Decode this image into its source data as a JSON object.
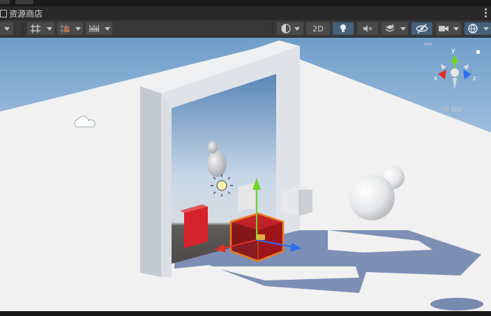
{
  "window": {
    "panel_title": "资源商店"
  },
  "toolbar": {
    "btn_2d_label": "2D"
  },
  "gizmo": {
    "axis_x": "x",
    "axis_y": "y",
    "axis_z": "z",
    "projection_label": "Iso"
  },
  "colors": {
    "selection_outline": "#f07a1e",
    "x_axis": "#e0302a",
    "y_axis": "#6fd624",
    "z_axis": "#2d6ff0",
    "toolbar_bg": "#383838",
    "active_button": "#46607c"
  }
}
